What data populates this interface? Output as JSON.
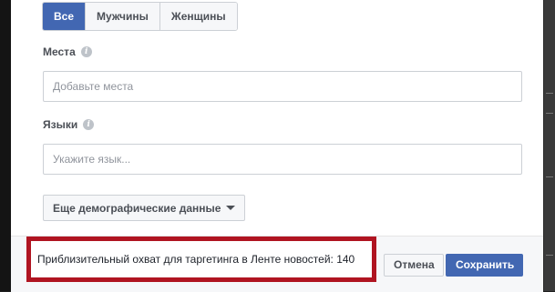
{
  "gender": {
    "options": [
      "Все",
      "Мужчины",
      "Женщины"
    ],
    "selected": "Все"
  },
  "locations": {
    "label": "Места",
    "placeholder": "Добавьте места"
  },
  "languages": {
    "label": "Языки",
    "placeholder": "Укажите язык..."
  },
  "more_demographics": {
    "label": "Еще демографические данные"
  },
  "reach": {
    "text": "Приблизительный охват для таргетинга в Ленте новостей: 140"
  },
  "actions": {
    "cancel_label": "Отмена",
    "save_label": "Сохранить"
  },
  "colors": {
    "accent": "#4267b2",
    "highlight_border": "#b01421"
  },
  "icons": {
    "info": "info-icon",
    "caret": "caret-down-icon"
  }
}
